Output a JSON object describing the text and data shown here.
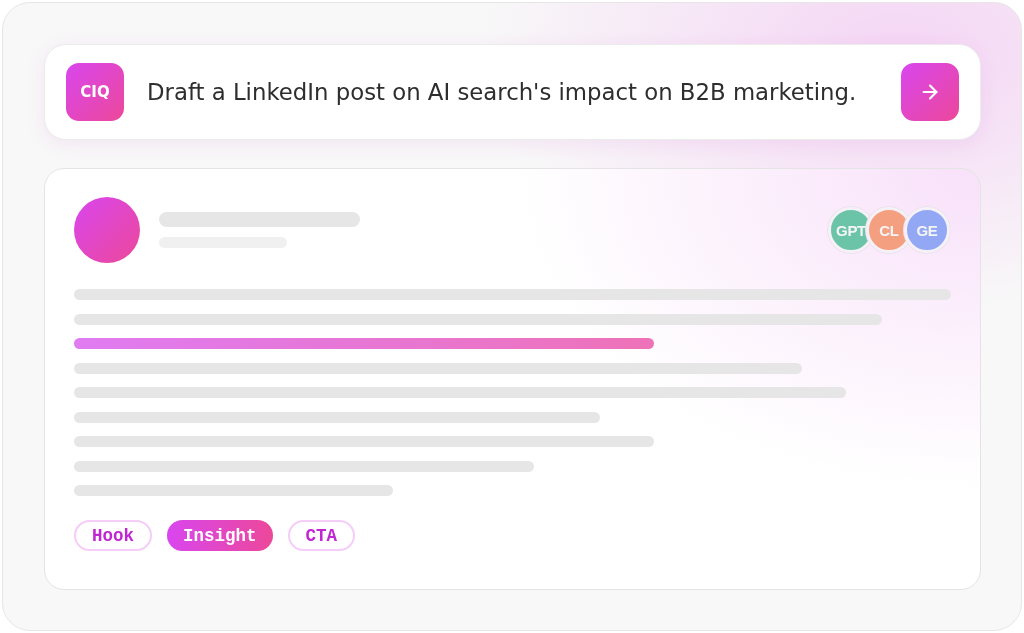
{
  "prompt_bar": {
    "logo": "CIQ",
    "prompt": "Draft a LinkedIn post on AI search's impact on B2B marketing."
  },
  "post_preview": {
    "models": [
      {
        "label": "GPT",
        "color": "#6cc4a8"
      },
      {
        "label": "CL",
        "color": "#f4a080"
      },
      {
        "label": "GE",
        "color": "#93a8f5"
      }
    ],
    "tags": [
      {
        "label": "Hook",
        "selected": false
      },
      {
        "label": "Insight",
        "selected": true
      },
      {
        "label": "CTA",
        "selected": false
      }
    ]
  }
}
